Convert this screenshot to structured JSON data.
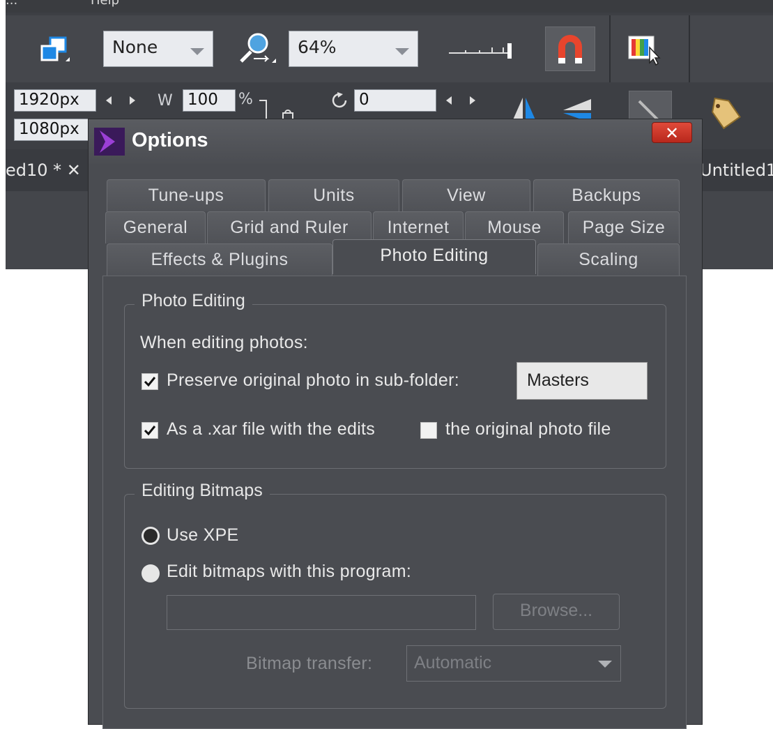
{
  "menubar": {
    "item1": "...",
    "item2": "Help"
  },
  "toolbar": {
    "quality_value": "None",
    "zoom_value": "64%"
  },
  "infobar": {
    "x_value": "1920px",
    "y_value": "1080px",
    "w_label": "W",
    "w_value": "100",
    "percent": "%",
    "rotate_value": "0"
  },
  "doc_tabs": {
    "left_tab": "ed10 * ✕",
    "right_tab": "Untitled1"
  },
  "dialog": {
    "title": "Options",
    "close_label": "✕",
    "tabs_row1": [
      "Tune-ups",
      "Units",
      "View",
      "Backups"
    ],
    "tabs_row2": [
      "General",
      "Grid and Ruler",
      "Internet",
      "Mouse",
      "Page Size"
    ],
    "tabs_row3": [
      "Effects & Plugins",
      "Photo Editing",
      "Scaling"
    ],
    "active_tab": "Photo Editing",
    "photo_editing": {
      "group_title": "Photo Editing",
      "when_editing": "When editing photos:",
      "preserve_label": "Preserve original photo in sub-folder:",
      "preserve_checked": true,
      "subfolder_value": "Masters",
      "as_xar_label": "As a .xar file with the edits",
      "as_xar_checked": true,
      "original_label": "the original photo file",
      "original_checked": false
    },
    "editing_bitmaps": {
      "group_title": "Editing Bitmaps",
      "use_xpe_label": "Use XPE",
      "use_xpe_selected": true,
      "edit_with_label": "Edit bitmaps with this program:",
      "program_path": "",
      "browse_label": "Browse...",
      "transfer_label": "Bitmap transfer:",
      "transfer_value": "Automatic"
    }
  }
}
